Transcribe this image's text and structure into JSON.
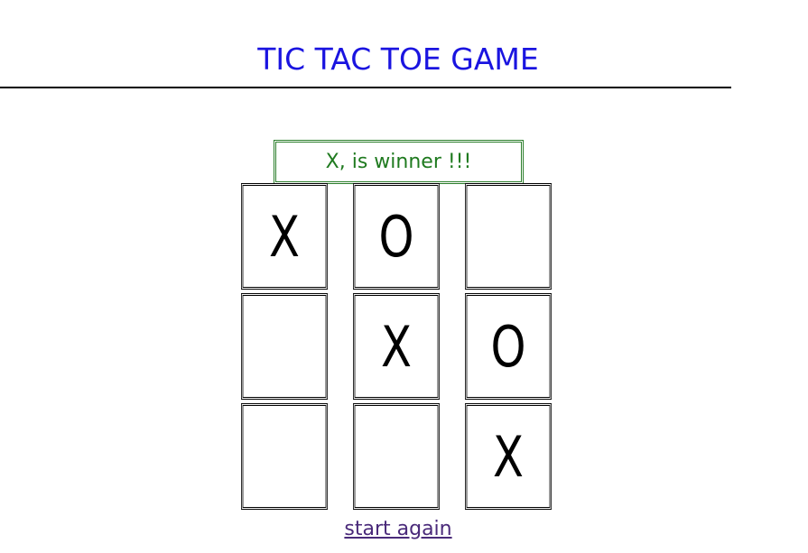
{
  "title": "TIC TAC TOE GAME",
  "status": "X, is winner !!!",
  "board": {
    "cells": [
      "X",
      "O",
      "",
      "",
      "X",
      "O",
      "",
      "",
      "X"
    ]
  },
  "restart_label": "start again",
  "colors": {
    "title": "#1a14e0",
    "status_text": "#1f7a1f",
    "status_border": "#2a7d2a",
    "link": "#4a2a7a"
  }
}
